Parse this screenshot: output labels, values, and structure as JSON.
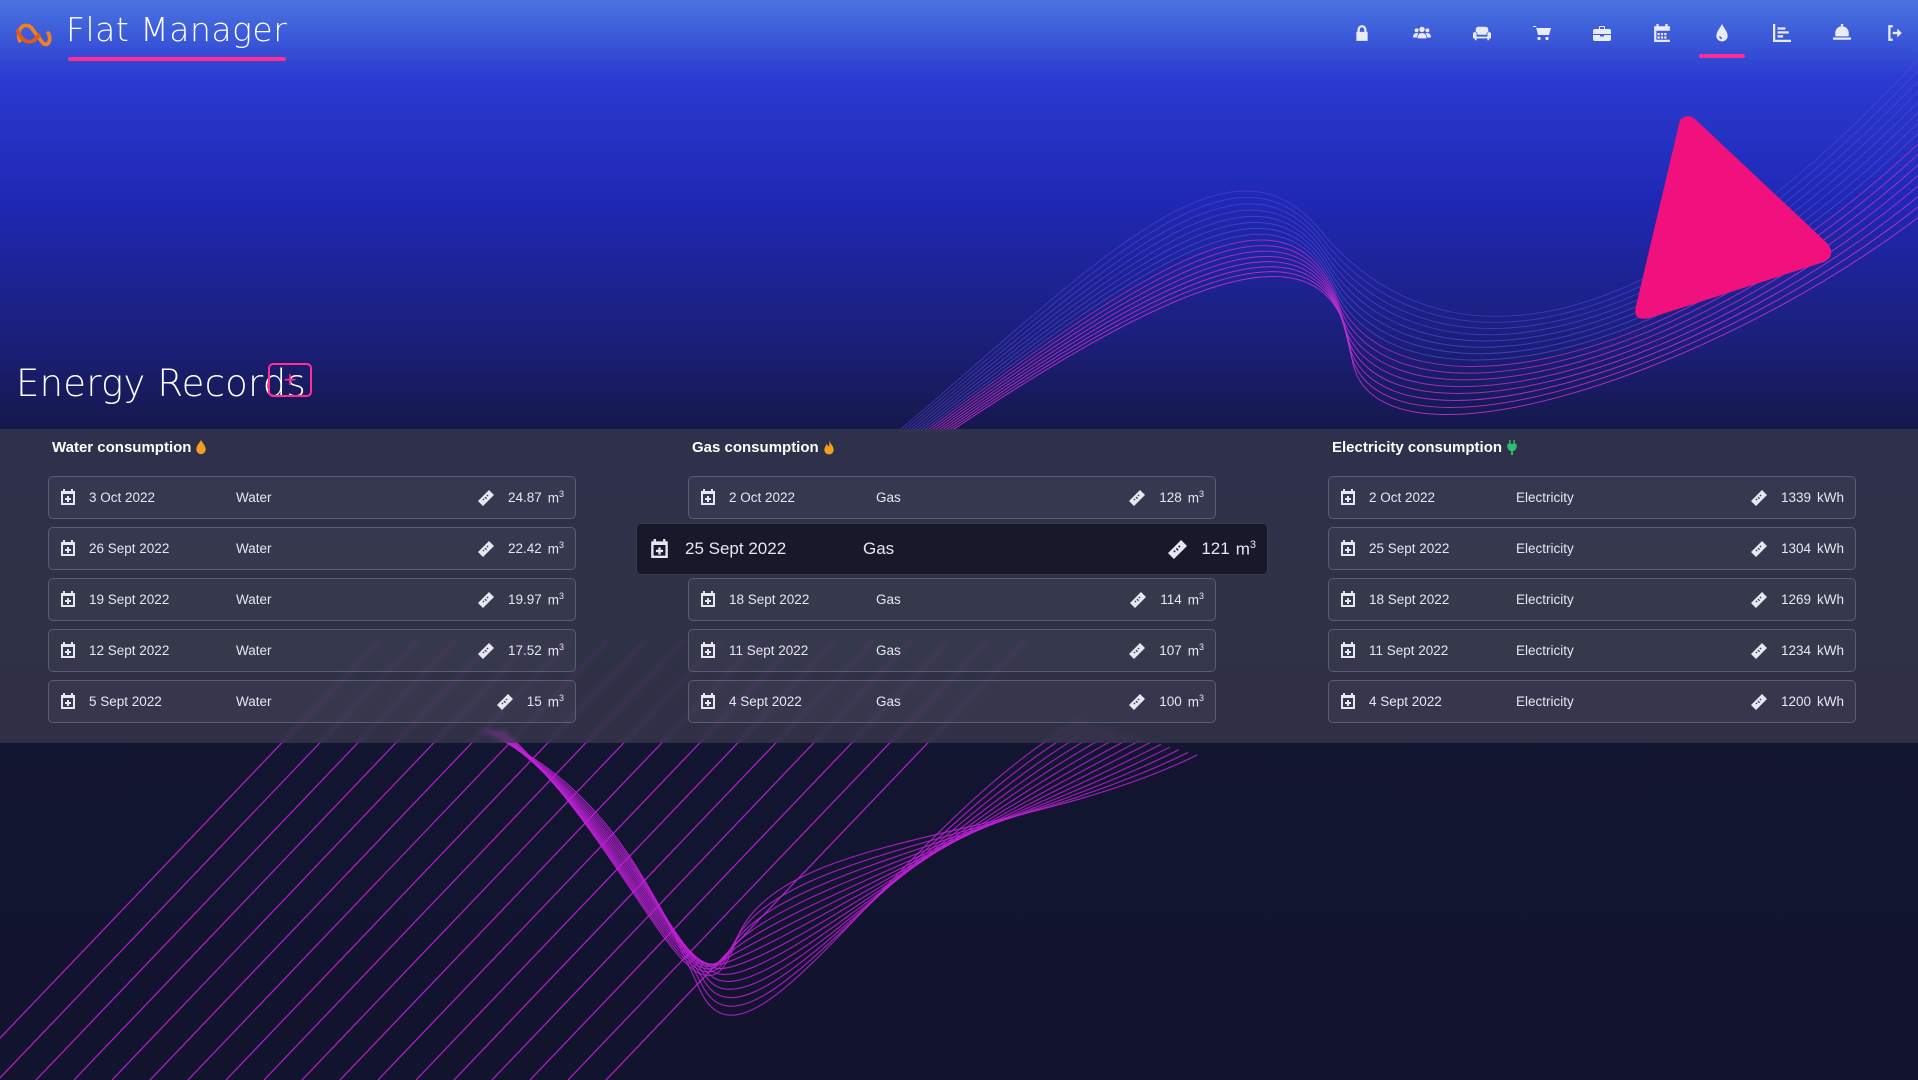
{
  "app": {
    "title": "Flat Manager"
  },
  "nav": {
    "items": [
      {
        "icon": "lock-icon"
      },
      {
        "icon": "users-icon"
      },
      {
        "icon": "couch-icon"
      },
      {
        "icon": "cart-icon"
      },
      {
        "icon": "briefcase-icon"
      },
      {
        "icon": "calendar-icon"
      },
      {
        "icon": "droplet-icon",
        "active": true
      },
      {
        "icon": "chart-icon"
      },
      {
        "icon": "bell-icon"
      },
      {
        "icon": "logout-icon"
      }
    ]
  },
  "page": {
    "title": "Energy Records",
    "add_label": "+"
  },
  "colors": {
    "accent": "#ff2d95",
    "water_icon": "#f0a020",
    "gas_icon": "#f0a020",
    "electricity_icon": "#2fbf6f"
  },
  "water": {
    "title": "Water consumption",
    "icon": "droplet-icon",
    "rows": [
      {
        "date": "3 Oct 2022",
        "type": "Water",
        "value": "24.87",
        "unit": "m",
        "sup": "3"
      },
      {
        "date": "26 Sept 2022",
        "type": "Water",
        "value": "22.42",
        "unit": "m",
        "sup": "3"
      },
      {
        "date": "19 Sept 2022",
        "type": "Water",
        "value": "19.97",
        "unit": "m",
        "sup": "3"
      },
      {
        "date": "12 Sept 2022",
        "type": "Water",
        "value": "17.52",
        "unit": "m",
        "sup": "3"
      },
      {
        "date": "5 Sept 2022",
        "type": "Water",
        "value": "15",
        "unit": "m",
        "sup": "3"
      }
    ]
  },
  "gas": {
    "title": "Gas consumption",
    "icon": "flame-icon",
    "rows": [
      {
        "date": "2 Oct 2022",
        "type": "Gas",
        "value": "128",
        "unit": "m",
        "sup": "3"
      },
      {
        "date": "25 Sept 2022",
        "type": "Gas",
        "value": "121",
        "unit": "m",
        "sup": "3"
      },
      {
        "date": "18 Sept 2022",
        "type": "Gas",
        "value": "114",
        "unit": "m",
        "sup": "3"
      },
      {
        "date": "11 Sept 2022",
        "type": "Gas",
        "value": "107",
        "unit": "m",
        "sup": "3"
      },
      {
        "date": "4 Sept 2022",
        "type": "Gas",
        "value": "100",
        "unit": "m",
        "sup": "3"
      }
    ]
  },
  "electricity": {
    "title": "Electricity consumption",
    "icon": "plug-icon",
    "rows": [
      {
        "date": "2 Oct 2022",
        "type": "Electricity",
        "value": "1339",
        "unit": "kWh"
      },
      {
        "date": "25 Sept 2022",
        "type": "Electricity",
        "value": "1304",
        "unit": "kWh"
      },
      {
        "date": "18 Sept 2022",
        "type": "Electricity",
        "value": "1269",
        "unit": "kWh"
      },
      {
        "date": "11 Sept 2022",
        "type": "Electricity",
        "value": "1234",
        "unit": "kWh"
      },
      {
        "date": "4 Sept 2022",
        "type": "Electricity",
        "value": "1200",
        "unit": "kWh"
      }
    ]
  }
}
